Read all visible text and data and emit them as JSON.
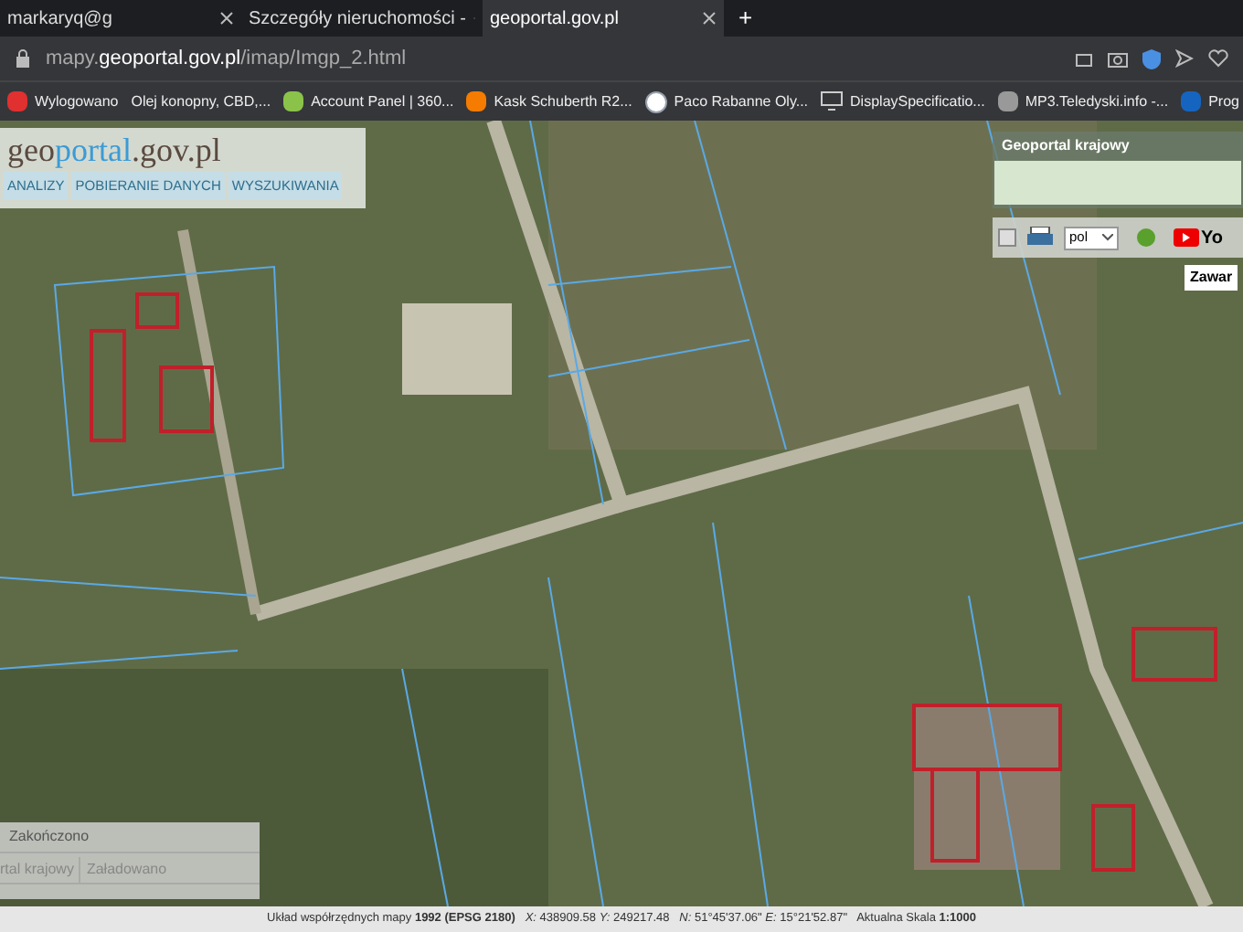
{
  "tabs": [
    {
      "label": "markaryq@g",
      "selected": false
    },
    {
      "label": "Szczegóły nieruchomości -",
      "selected": false
    },
    {
      "label": "geoportal.gov.pl",
      "selected": true
    }
  ],
  "new_tab": "+",
  "address": {
    "prefix": "mapy.",
    "host": "geoportal.gov.pl",
    "path": "/imap/Imgp_2.html"
  },
  "bookmarks": [
    {
      "label": "Wylogowano",
      "kind": "red"
    },
    {
      "label": "Olej konopny, CBD,...",
      "kind": "none"
    },
    {
      "label": "Account Panel | 360...",
      "kind": "green"
    },
    {
      "label": "Kask Schuberth R2...",
      "kind": "orange"
    },
    {
      "label": "Paco Rabanne Oly...",
      "kind": "n"
    },
    {
      "label": "DisplaySpecificatio...",
      "kind": "monitor"
    },
    {
      "label": "MP3.Teledyski.info -...",
      "kind": "note"
    },
    {
      "label": "Prog",
      "kind": "blue"
    }
  ],
  "logo": {
    "part1": "geo",
    "part2": "portal",
    "part3": ".gov.pl"
  },
  "menu": [
    {
      "label": "ANALIZY"
    },
    {
      "label": "POBIERANIE DANYCH"
    },
    {
      "label": "WYSZUKIWANIA"
    }
  ],
  "overview": {
    "title": "Geoportal krajowy"
  },
  "language": {
    "value": "pol"
  },
  "youtube": "Yo",
  "tooltip": "Zawar",
  "progress": {
    "status": "Zakończono",
    "source": "rtal krajowy",
    "state": "Załadowano"
  },
  "status_bar": "Układ współrzędnych mapy **1992 (EPSG 2180)**   *X:* 438909.58 *Y:* 249217.48   *N:* 51°45'37.06\" *E:* 15°21'52.87\"   Aktualna Skala **1:1000**"
}
